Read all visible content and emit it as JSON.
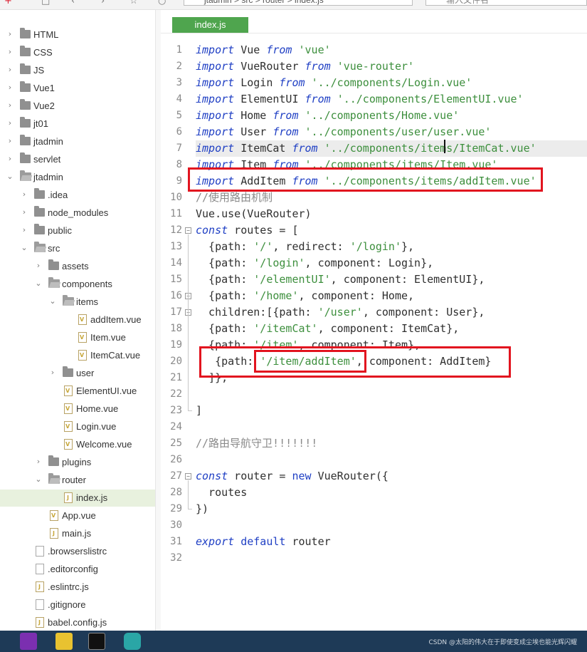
{
  "toolbar": {
    "path_text": "jtadmin  >  src  >  router  >  index.js",
    "search_placeholder": "输入文件名"
  },
  "sidebar": {
    "items": [
      {
        "label": "HTML",
        "kind": "folder",
        "depth": 0,
        "expanded": false
      },
      {
        "label": "CSS",
        "kind": "folder",
        "depth": 0,
        "expanded": false
      },
      {
        "label": "JS",
        "kind": "folder",
        "depth": 0,
        "expanded": false
      },
      {
        "label": "Vue1",
        "kind": "folder",
        "depth": 0,
        "expanded": false
      },
      {
        "label": "Vue2",
        "kind": "folder",
        "depth": 0,
        "expanded": false
      },
      {
        "label": "jt01",
        "kind": "folder",
        "depth": 0,
        "expanded": false
      },
      {
        "label": "jtadmin",
        "kind": "folder",
        "depth": 0,
        "expanded": false
      },
      {
        "label": "servlet",
        "kind": "folder",
        "depth": 0,
        "expanded": false
      },
      {
        "label": "jtadmin",
        "kind": "folder",
        "depth": 0,
        "expanded": true
      },
      {
        "label": ".idea",
        "kind": "folder",
        "depth": 1,
        "expanded": false
      },
      {
        "label": "node_modules",
        "kind": "folder",
        "depth": 1,
        "expanded": false
      },
      {
        "label": "public",
        "kind": "folder",
        "depth": 1,
        "expanded": false
      },
      {
        "label": "src",
        "kind": "folder",
        "depth": 1,
        "expanded": true
      },
      {
        "label": "assets",
        "kind": "folder",
        "depth": 2,
        "expanded": false
      },
      {
        "label": "components",
        "kind": "folder",
        "depth": 2,
        "expanded": true
      },
      {
        "label": "items",
        "kind": "folder",
        "depth": 3,
        "expanded": true
      },
      {
        "label": "addItem.vue",
        "kind": "vue",
        "depth": 4
      },
      {
        "label": "Item.vue",
        "kind": "vue",
        "depth": 4
      },
      {
        "label": "ItemCat.vue",
        "kind": "vue",
        "depth": 4
      },
      {
        "label": "user",
        "kind": "folder",
        "depth": 3,
        "expanded": false
      },
      {
        "label": "ElementUI.vue",
        "kind": "vue",
        "depth": 3
      },
      {
        "label": "Home.vue",
        "kind": "vue",
        "depth": 3
      },
      {
        "label": "Login.vue",
        "kind": "vue",
        "depth": 3
      },
      {
        "label": "Welcome.vue",
        "kind": "vue",
        "depth": 3
      },
      {
        "label": "plugins",
        "kind": "folder",
        "depth": 2,
        "expanded": false
      },
      {
        "label": "router",
        "kind": "folder",
        "depth": 2,
        "expanded": true
      },
      {
        "label": "index.js",
        "kind": "js",
        "depth": 3,
        "selected": true
      },
      {
        "label": "App.vue",
        "kind": "vue",
        "depth": 2
      },
      {
        "label": "main.js",
        "kind": "js",
        "depth": 2
      },
      {
        "label": ".browserslistrc",
        "kind": "file",
        "depth": 1
      },
      {
        "label": ".editorconfig",
        "kind": "file",
        "depth": 1
      },
      {
        "label": ".eslintrc.js",
        "kind": "js",
        "depth": 1
      },
      {
        "label": ".gitignore",
        "kind": "file",
        "depth": 1
      },
      {
        "label": "babel.config.js",
        "kind": "js",
        "depth": 1
      }
    ]
  },
  "editor": {
    "active_tab": "index.js",
    "lines": [
      {
        "n": "1",
        "parts": [
          [
            "kw",
            "import"
          ],
          [
            "pl",
            " Vue "
          ],
          [
            "kw",
            "from"
          ],
          [
            "pl",
            " "
          ],
          [
            "str",
            "'vue'"
          ]
        ]
      },
      {
        "n": "2",
        "parts": [
          [
            "kw",
            "import"
          ],
          [
            "pl",
            " VueRouter "
          ],
          [
            "kw",
            "from"
          ],
          [
            "pl",
            " "
          ],
          [
            "str",
            "'vue-router'"
          ]
        ]
      },
      {
        "n": "3",
        "parts": [
          [
            "kw",
            "import"
          ],
          [
            "pl",
            " Login "
          ],
          [
            "kw",
            "from"
          ],
          [
            "pl",
            " "
          ],
          [
            "str",
            "'../components/Login.vue'"
          ]
        ]
      },
      {
        "n": "4",
        "parts": [
          [
            "kw",
            "import"
          ],
          [
            "pl",
            " ElementUI "
          ],
          [
            "kw",
            "from"
          ],
          [
            "pl",
            " "
          ],
          [
            "str",
            "'../components/ElementUI.vue'"
          ]
        ]
      },
      {
        "n": "5",
        "parts": [
          [
            "kw",
            "import"
          ],
          [
            "pl",
            " Home "
          ],
          [
            "kw",
            "from"
          ],
          [
            "pl",
            " "
          ],
          [
            "str",
            "'../components/Home.vue'"
          ]
        ]
      },
      {
        "n": "6",
        "parts": [
          [
            "kw",
            "import"
          ],
          [
            "pl",
            " User "
          ],
          [
            "kw",
            "from"
          ],
          [
            "pl",
            " "
          ],
          [
            "str",
            "'../components/user/user.vue'"
          ]
        ]
      },
      {
        "n": "7",
        "parts": [
          [
            "kw",
            "import"
          ],
          [
            "pl",
            " ItemCat "
          ],
          [
            "kw",
            "from"
          ],
          [
            "pl",
            " "
          ],
          [
            "str",
            "'../components/items/ItemCat.vue'"
          ]
        ],
        "highlighted": true
      },
      {
        "n": "8",
        "parts": [
          [
            "kw",
            "import"
          ],
          [
            "pl",
            " Item "
          ],
          [
            "kw",
            "from"
          ],
          [
            "pl",
            " "
          ],
          [
            "str",
            "'../components/items/Item.vue'"
          ]
        ]
      },
      {
        "n": "9",
        "parts": [
          [
            "kw",
            "import"
          ],
          [
            "pl",
            " AddItem "
          ],
          [
            "kw",
            "from"
          ],
          [
            "pl",
            " "
          ],
          [
            "str",
            "'../components/items/addItem.vue'"
          ]
        ]
      },
      {
        "n": "10",
        "parts": [
          [
            "cm",
            "//使用路由机制"
          ]
        ]
      },
      {
        "n": "11",
        "parts": [
          [
            "pl",
            "Vue.use(VueRouter)"
          ]
        ]
      },
      {
        "n": "12",
        "parts": [
          [
            "kw",
            "const"
          ],
          [
            "pl",
            " routes = ["
          ]
        ]
      },
      {
        "n": "13",
        "parts": [
          [
            "pl",
            "  {path: "
          ],
          [
            "str",
            "'/'"
          ],
          [
            "pl",
            ", redirect: "
          ],
          [
            "str",
            "'/login'"
          ],
          [
            "pl",
            "},"
          ]
        ]
      },
      {
        "n": "14",
        "parts": [
          [
            "pl",
            "  {path: "
          ],
          [
            "str",
            "'/login'"
          ],
          [
            "pl",
            ", component: Login},"
          ]
        ]
      },
      {
        "n": "15",
        "parts": [
          [
            "pl",
            "  {path: "
          ],
          [
            "str",
            "'/elementUI'"
          ],
          [
            "pl",
            ", component: ElementUI},"
          ]
        ]
      },
      {
        "n": "16",
        "parts": [
          [
            "pl",
            "  {path: "
          ],
          [
            "str",
            "'/home'"
          ],
          [
            "pl",
            ", component: Home,"
          ]
        ]
      },
      {
        "n": "17",
        "parts": [
          [
            "pl",
            "  children:[{path: "
          ],
          [
            "str",
            "'/user'"
          ],
          [
            "pl",
            ", component: User},"
          ]
        ]
      },
      {
        "n": "18",
        "parts": [
          [
            "pl",
            "  {path: "
          ],
          [
            "str",
            "'/itemCat'"
          ],
          [
            "pl",
            ", component: ItemCat},"
          ]
        ]
      },
      {
        "n": "19",
        "parts": [
          [
            "pl",
            "  {path: "
          ],
          [
            "str",
            "'/item'"
          ],
          [
            "pl",
            ", component: Item},"
          ]
        ]
      },
      {
        "n": "20",
        "parts": [
          [
            "pl",
            "   {path: "
          ],
          [
            "str",
            "'/item/addItem'"
          ],
          [
            "pl",
            ", component: AddItem}"
          ]
        ]
      },
      {
        "n": "21",
        "parts": [
          [
            "pl",
            "  ]},"
          ]
        ]
      },
      {
        "n": "22",
        "parts": []
      },
      {
        "n": "23",
        "parts": [
          [
            "pl",
            "]"
          ]
        ]
      },
      {
        "n": "24",
        "parts": []
      },
      {
        "n": "25",
        "parts": [
          [
            "cm",
            "//路由导航守卫!!!!!!!"
          ]
        ]
      },
      {
        "n": "26",
        "parts": []
      },
      {
        "n": "27",
        "parts": [
          [
            "kw",
            "const"
          ],
          [
            "pl",
            " router = "
          ],
          [
            "kwn",
            "new"
          ],
          [
            "pl",
            " VueRouter({"
          ]
        ]
      },
      {
        "n": "28",
        "parts": [
          [
            "pl",
            "  routes"
          ]
        ]
      },
      {
        "n": "29",
        "parts": [
          [
            "pl",
            "})"
          ]
        ]
      },
      {
        "n": "30",
        "parts": []
      },
      {
        "n": "31",
        "parts": [
          [
            "kw",
            "export"
          ],
          [
            "pl",
            " "
          ],
          [
            "kwn",
            "default"
          ],
          [
            "pl",
            " router"
          ]
        ]
      },
      {
        "n": "32",
        "parts": []
      }
    ]
  },
  "taskbar": {
    "watermark": "CSDN @太阳的伟大在于即使变成尘埃也能光辉闪耀"
  },
  "colors": {
    "tab_active": "#4fa54e",
    "keyword": "#1f3fc4",
    "string": "#3d8f3d",
    "comment": "#8a8a8a",
    "annotation_box": "#e2141f",
    "selected_row": "#e8f1de"
  }
}
